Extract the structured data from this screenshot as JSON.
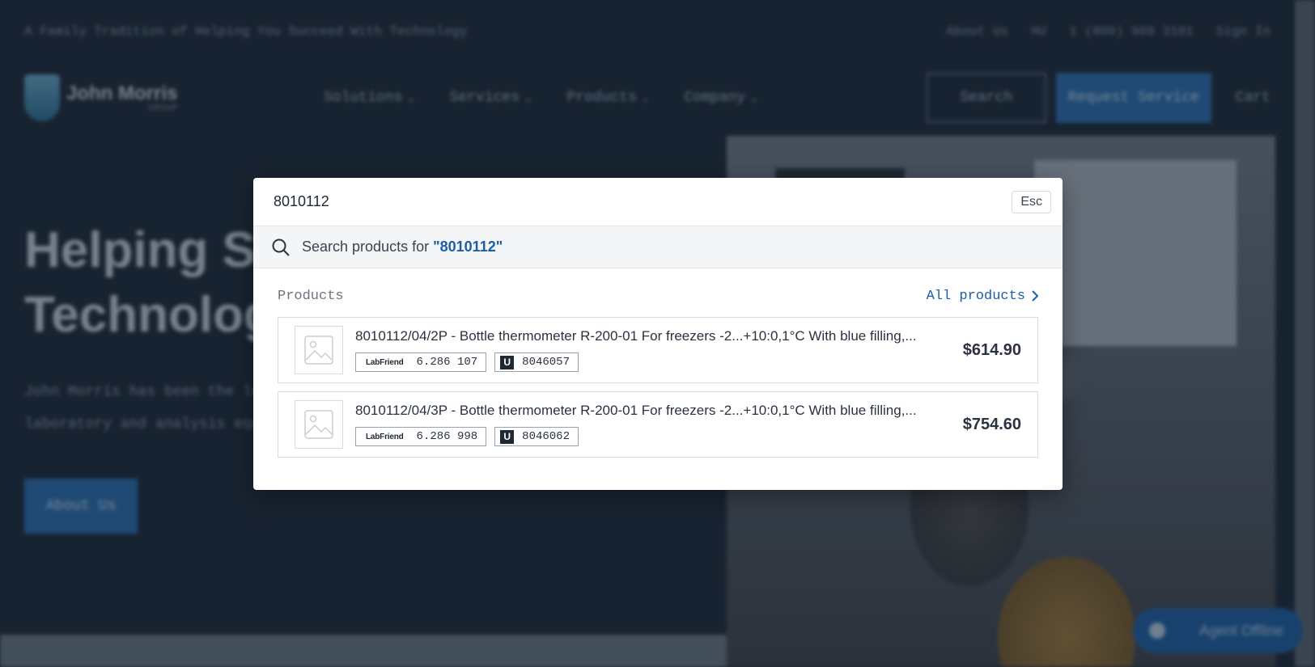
{
  "background_page": {
    "tagline": "A Family Tradition of Helping You Succeed With Technology",
    "about_link": "About Us",
    "region": "HU",
    "phone": "1 (800) 969 3101",
    "sign_in": "Sign In",
    "logo_name": "John Morris",
    "logo_sub": "GROUP",
    "nav": [
      "Solutions",
      "Services",
      "Products",
      "Company"
    ],
    "search_button": "Search",
    "request_button": "Request Service",
    "cart": "Cart",
    "hero_title_line1": "Helping Sc",
    "hero_title_line2": "Technolog",
    "hero_text_line1": "John Morris has been the lea",
    "hero_text_line2": "laboratory and analysis equip",
    "hero_button": "About Us",
    "agent_chat": "Agent Offline"
  },
  "search_modal": {
    "query": "8010112",
    "esc_label": "Esc",
    "suggest_prefix": "Search products for ",
    "suggest_query": "\"8010112\"",
    "section_title": "Products",
    "all_products_link": "All products",
    "results": [
      {
        "title": "8010112/04/2P - Bottle thermometer R-200-01 For freezers -2...+10:0,1°C With blue filling,...",
        "labfriend_brand": "LabFriend",
        "labfriend_code": "6.286 107",
        "u_brand": "U",
        "u_code": "8046057",
        "price": "$614.90"
      },
      {
        "title": "8010112/04/3P - Bottle thermometer R-200-01 For freezers -2...+10:0,1°C With blue filling,...",
        "labfriend_brand": "LabFriend",
        "labfriend_code": "6.286 998",
        "u_brand": "U",
        "u_code": "8046062",
        "price": "$754.60"
      }
    ]
  },
  "colors": {
    "accent": "#1a5fa6",
    "overlay": "#1c2735",
    "text": "#2a3240"
  }
}
